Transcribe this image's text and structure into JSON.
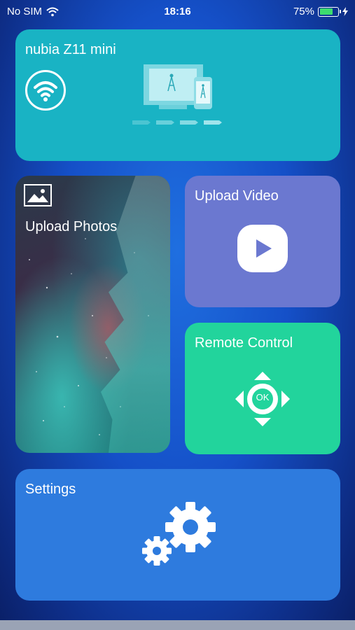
{
  "status_bar": {
    "carrier": "No SIM",
    "time": "18:16",
    "battery_text": "75%",
    "battery_level": 0.75,
    "icons": [
      "wifi-icon",
      "battery-icon",
      "charging-bolt-icon"
    ]
  },
  "device": {
    "name": "nubia Z11 mini",
    "icons": [
      "wifi-icon",
      "screen-cast-icon"
    ]
  },
  "tiles": {
    "photos": {
      "label": "Upload Photos",
      "icon": "image-icon"
    },
    "video": {
      "label": "Upload Video",
      "icon": "play-icon"
    },
    "remote": {
      "label": "Remote Control",
      "icon": "dpad-icon",
      "ok_label": "OK"
    },
    "settings": {
      "label": "Settings",
      "icon": "gears-icon"
    }
  },
  "colors": {
    "device_card": "#19b3c4",
    "video_card": "#6b78d0",
    "remote_card": "#22d49c",
    "settings_card": "#2e7bde",
    "battery_fill": "#3ddc6e"
  }
}
